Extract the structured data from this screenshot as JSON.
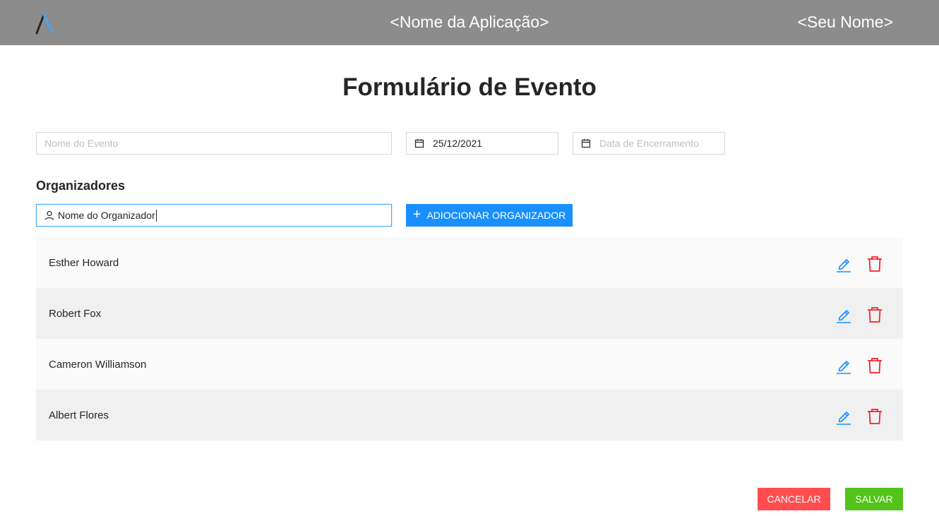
{
  "header": {
    "app_name": "<Nome da Aplicação>",
    "user_name": "<Seu Nome>",
    "logo_icon": "logo-icon"
  },
  "form": {
    "title": "Formulário de Evento",
    "event_name_placeholder": "Nome do Evento",
    "start_date_value": "25/12/2021",
    "end_date_placeholder": "Data de Encerramento"
  },
  "organizers": {
    "section_title": "Organizadores",
    "input_value": "Nome do Organizador",
    "add_button_label": "ADIOCIONAR ORGANIZADOR",
    "items": [
      {
        "name": "Esther Howard"
      },
      {
        "name": "Robert Fox"
      },
      {
        "name": "Cameron Williamson"
      },
      {
        "name": "Albert Flores"
      }
    ]
  },
  "actions": {
    "cancel_label": "CANCELAR",
    "save_label": "SALVAR"
  },
  "colors": {
    "header_bg": "#8c8c8c",
    "primary": "#1890ff",
    "danger": "#ff4d4f",
    "success": "#52c41a"
  }
}
